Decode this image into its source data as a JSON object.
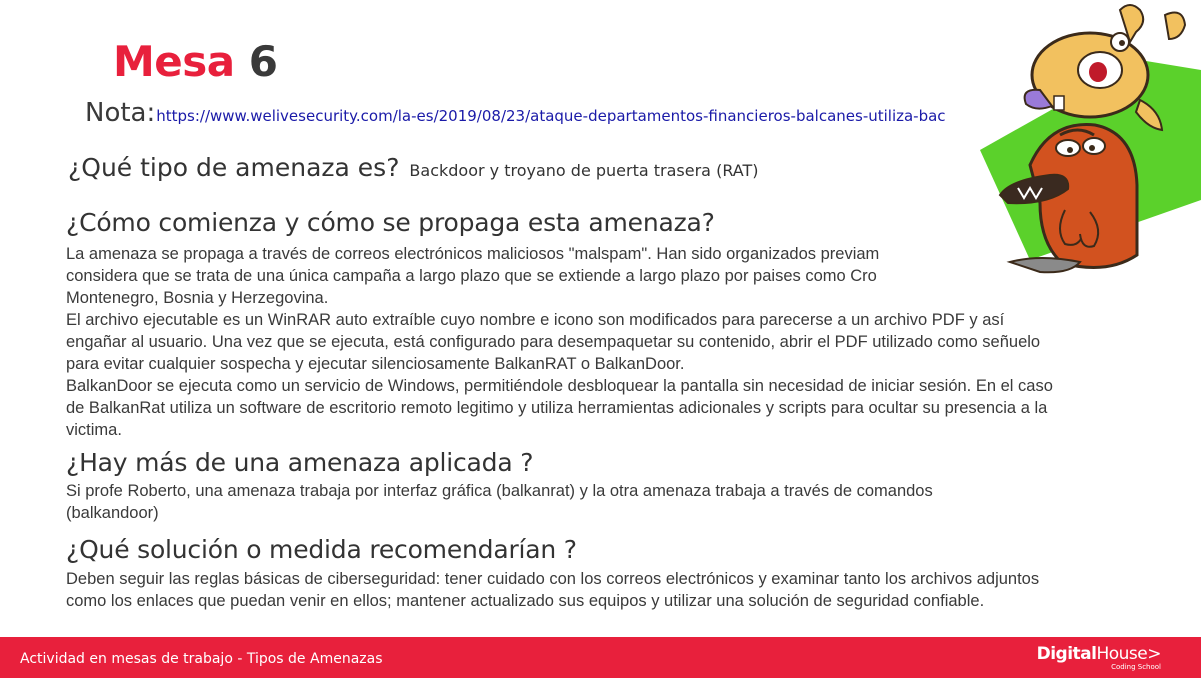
{
  "slide": {
    "title_word": "Mesa",
    "title_number": "6",
    "nota_label": "Nota:",
    "nota_url": "https://www.welivesecurity.com/la-es/2019/08/23/ataque-departamentos-financieros-balcanes-utiliza-bac",
    "q1": {
      "question": "¿Qué tipo de amenaza es?",
      "answer": "Backdoor y troyano de puerta trasera (RAT)"
    },
    "q2": {
      "question": "¿Cómo comienza y cómo se propaga esta amenaza?",
      "lines": [
        "La amenaza se propaga a través de correos electrónicos maliciosos \"malspam\". Han sido organizados previam",
        "considera que se trata de una única campaña a largo plazo que se extiende a largo plazo por paises como Cro",
        "Montenegro, Bosnia y Herzegovina.",
        "El archivo ejecutable es un WinRAR auto extraíble cuyo nombre e icono son modificados para parecerse a un archivo PDF y así",
        "engañar al usuario. Una vez que se ejecuta, está configurado para desempaquetar su contenido, abrir el PDF utilizado como señuelo",
        "para evitar cualquier sospecha y ejecutar silenciosamente BalkanRAT o BalkanDoor.",
        "BalkanDoor se ejecuta como un servicio de Windows, permitiéndole desbloquear la pantalla sin necesidad de iniciar sesión. En el caso",
        "de BalkanRat utiliza un software de escritorio remoto legitimo y utiliza herramientas adicionales y scripts para ocultar su presencia a la",
        "victima."
      ]
    },
    "q3": {
      "question": "¿Hay más de una amenaza aplicada ?",
      "lines": [
        "Si profe Roberto, una amenaza trabaja por interfaz gráfica (balkanrat) y la otra amenaza trabaja a través de comandos",
        "(balkandoor)"
      ]
    },
    "q4": {
      "question": "¿Qué solución o medida recomendarían ?",
      "lines": [
        "Deben seguir las reglas básicas de ciberseguridad: tener cuidado con los correos electrónicos y examinar tanto los archivos adjuntos",
        "como los enlaces que puedan venir en ellos; mantener actualizado sus equipos y utilizar una solución de seguridad confiable."
      ]
    }
  },
  "footer": {
    "text": "Actividad en mesas de trabajo - Tipos de Amenazas",
    "logo_bold": "Digital",
    "logo_thin": "House>",
    "logo_sub": "Coding School"
  },
  "colors": {
    "accent": "#e8203c",
    "text": "#333333",
    "link": "#1a1aa8",
    "illustration_green": "#5bd12b",
    "beaver_orange": "#d2521f",
    "beaver_tan": "#f2c15f"
  },
  "icons": [
    "beavers-illustration"
  ]
}
